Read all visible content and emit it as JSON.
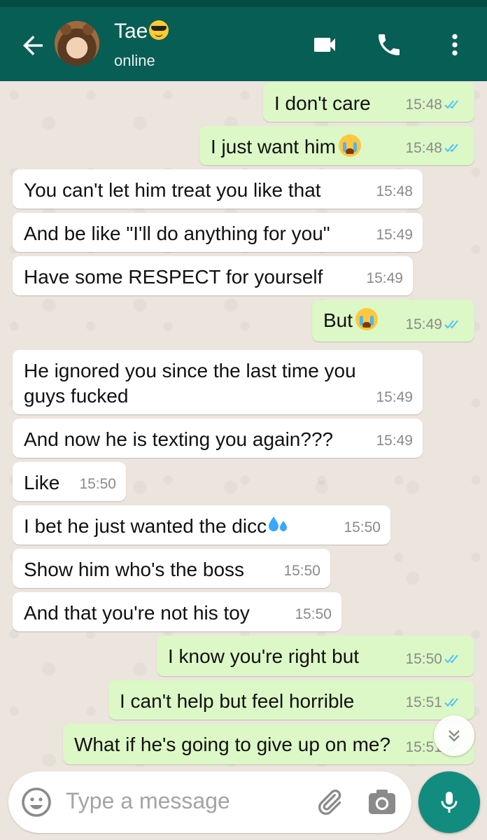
{
  "header": {
    "contact_name": "Tae",
    "contact_emoji": "sunglasses-emoji",
    "status": "online",
    "colors": {
      "bar": "#075e54",
      "status_bar": "#054d44"
    }
  },
  "messages": [
    {
      "dir": "out",
      "text": "I don't care",
      "time": "15:48",
      "read": true
    },
    {
      "dir": "out",
      "text": "I just want him",
      "emoji": "loudly-crying-emoji",
      "time": "15:48",
      "read": true
    },
    {
      "dir": "in",
      "text": "You can't let him treat you like that",
      "time": "15:48"
    },
    {
      "dir": "in",
      "text": "And be like \"I'll do anything for you\"",
      "time": "15:49"
    },
    {
      "dir": "in",
      "text": "Have some RESPECT for yourself",
      "time": "15:49"
    },
    {
      "dir": "out",
      "text": "But",
      "emoji": "loudly-crying-emoji",
      "time": "15:49",
      "read": true
    },
    {
      "dir": "in",
      "text": "He ignored you since the last time you\nguys fucked",
      "time": "15:49"
    },
    {
      "dir": "in",
      "text": "And now he is texting you again???",
      "time": "15:49"
    },
    {
      "dir": "in",
      "text": "Like",
      "time": "15:50"
    },
    {
      "dir": "in",
      "text": "I bet he just wanted the dicc",
      "emoji": "sweat-droplets-emoji",
      "time": "15:50"
    },
    {
      "dir": "in",
      "text": "Show him who's the boss",
      "time": "15:50"
    },
    {
      "dir": "in",
      "text": "And that you're not his toy",
      "time": "15:50"
    },
    {
      "dir": "out",
      "text": "I know you're right but",
      "time": "15:50",
      "read": true
    },
    {
      "dir": "out",
      "text": "I can't help but feel horrible",
      "time": "15:51",
      "read": true
    },
    {
      "dir": "out",
      "text": "What if he's going to give up on me?",
      "time": "15:51",
      "read": true
    }
  ],
  "composer": {
    "placeholder": "Type a message"
  },
  "colors": {
    "incoming": "#ffffff",
    "outgoing": "#dcf8c6",
    "read_ticks": "#4fc3f7",
    "mic": "#128c7e"
  }
}
